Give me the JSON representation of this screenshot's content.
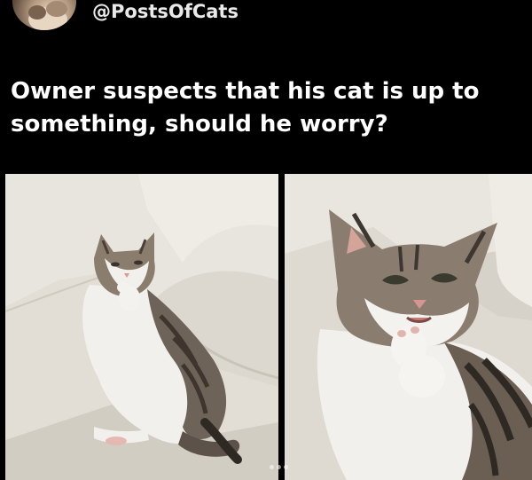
{
  "post": {
    "handle": "@PostsOfCats",
    "text": "Owner suspects that his cat is up to something, should he worry?"
  },
  "media": {
    "count": 2,
    "images": [
      {
        "name": "cat-lying-on-couch-photo"
      },
      {
        "name": "cat-closeup-photo"
      }
    ]
  },
  "icons": [
    "avatar-image",
    "carousel-dots"
  ],
  "colors": {
    "background": "#000000",
    "text": "#ffffff",
    "couch": "#e4e0d8"
  }
}
